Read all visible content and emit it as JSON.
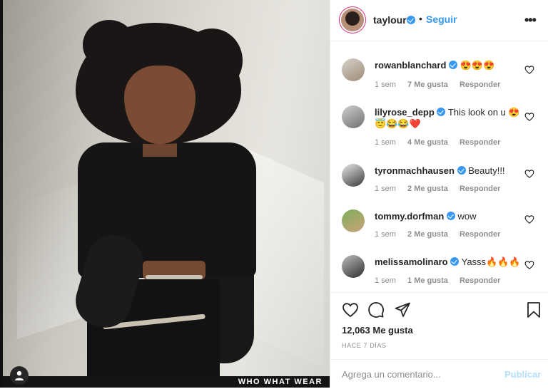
{
  "post": {
    "photo_watermark": "WHO WHAT WEAR",
    "author": {
      "username": "taylour",
      "verified": true
    },
    "follow_label": "Seguir",
    "separator": "•",
    "more_label": "•••"
  },
  "comments": [
    {
      "username": "rowanblanchard",
      "text": "😍😍😍",
      "time": "1 sem",
      "likes": "7 Me gusta",
      "reply": "Responder"
    },
    {
      "username": "lilyrose_depp",
      "text": "This look on u 😍😇😂😂❤️",
      "time": "1 sem",
      "likes": "4 Me gusta",
      "reply": "Responder"
    },
    {
      "username": "tyronmachhausen",
      "text": "Beauty!!!",
      "time": "1 sem",
      "likes": "2 Me gusta",
      "reply": "Responder"
    },
    {
      "username": "tommy.dorfman",
      "text": "wow",
      "time": "1 sem",
      "likes": "2 Me gusta",
      "reply": "Responder"
    },
    {
      "username": "melissamolinaro",
      "text": "Yasss🔥🔥🔥",
      "time": "1 sem",
      "likes": "1 Me gusta",
      "reply": "Responder"
    }
  ],
  "actions": {
    "likes_count": "12,063 Me gusta",
    "time_ago": "HACE 7 DÍAS"
  },
  "add_comment": {
    "placeholder": "Agrega un comentario...",
    "post_label": "Publicar"
  },
  "colors": {
    "link_blue": "#3897f0",
    "post_disabled": "#b2dffc",
    "muted": "#8e8e8e",
    "text": "#262626"
  },
  "icons": [
    "heart-icon",
    "comment-icon",
    "share-icon",
    "bookmark-icon",
    "verified-icon",
    "more-icon",
    "user-icon"
  ]
}
